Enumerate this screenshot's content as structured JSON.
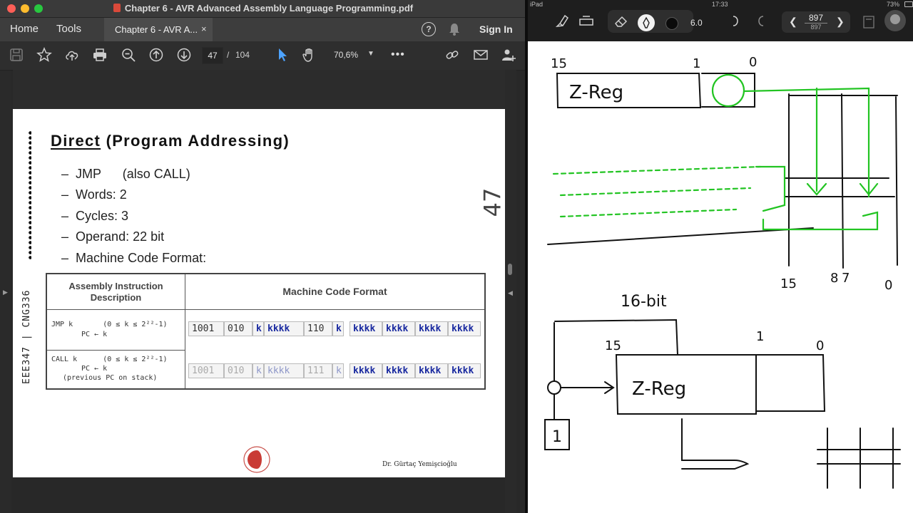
{
  "window": {
    "title": "Chapter 6 - AVR Advanced Assembly Language Programming.pdf",
    "nav": {
      "home": "Home",
      "tools": "Tools",
      "tab_label": "Chapter 6 - AVR A...",
      "tab_close": "×",
      "signin": "Sign In"
    },
    "toolbar": {
      "page_current": "47",
      "page_sep": "/",
      "page_total": "104",
      "zoom": "70,6%"
    },
    "colors": {
      "accent": "#4da3ff",
      "close": "#fe5f57",
      "minimize": "#febc2e",
      "zoom_light": "#28c840"
    }
  },
  "slide": {
    "vertical_label": "EEE347 | CNG336",
    "title_underlined": "Direct",
    "title_rest": " (Program Addressing)",
    "bullets": [
      "JMP      (also CALL)",
      "Words: 2",
      "Cycles: 3",
      "Operand: 22 bit",
      "Machine Code Format:"
    ],
    "bullet_dash": "–",
    "page_mark": "47",
    "table": {
      "col1": "Assembly Instruction Description",
      "col2": "Machine Code Format",
      "rows": [
        {
          "line1": "JMP k       (0 ≤ k ≤ 2²²-1)",
          "line2": "PC ← k",
          "line3": "",
          "cells": [
            "1001",
            "010",
            "k",
            "kkkk",
            "110",
            "k",
            "kkkk",
            "kkkk",
            "kkkk",
            "kkkk"
          ]
        },
        {
          "line1": "CALL k      (0 ≤ k ≤ 2²²-1)",
          "line2": "PC ← k",
          "line3": "(previous PC on stack)",
          "cells": [
            "1001",
            "010",
            "k",
            "kkkk",
            "111",
            "k",
            "kkkk",
            "kkkk",
            "kkkk",
            "kkkk"
          ]
        }
      ]
    },
    "footer": "Dr. Gürtaç Yemişcioğlu"
  },
  "ipad": {
    "status": {
      "device": "iPad",
      "time": "17:33",
      "battery": "73%"
    },
    "pen_size": "6.0",
    "page_current": "897",
    "page_total": "897",
    "sketch_labels": [
      "15",
      "1",
      "0",
      "Z-Reg",
      "15",
      "8",
      "7",
      "0",
      "16-bit",
      "15",
      "1",
      "0",
      "Z-Reg",
      "1"
    ]
  }
}
